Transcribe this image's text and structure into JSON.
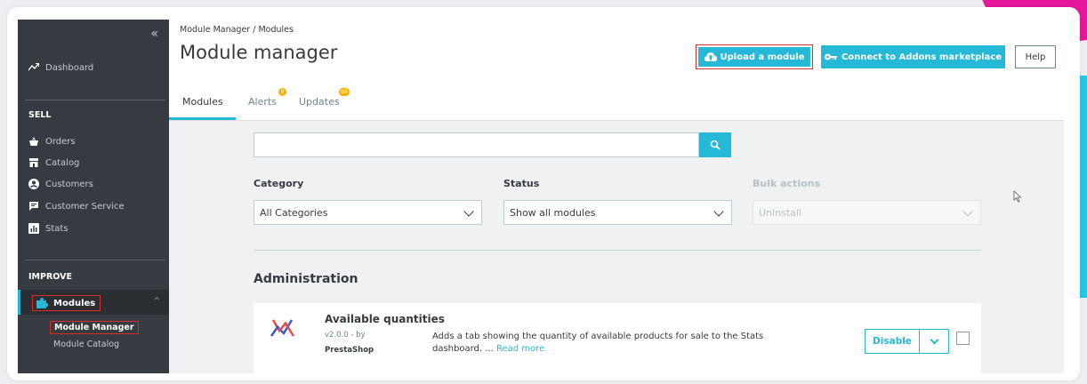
{
  "sidebar": {
    "collapse_glyph": "«",
    "dashboard": "Dashboard",
    "sell_heading": "SELL",
    "sell_items": [
      "Orders",
      "Catalog",
      "Customers",
      "Customer Service",
      "Stats"
    ],
    "improve_heading": "IMPROVE",
    "modules": "Modules",
    "sub_items": [
      "Module Manager",
      "Module Catalog"
    ]
  },
  "header": {
    "breadcrumb": "Module Manager / Modules",
    "title": "Module manager",
    "upload_label": "Upload a module",
    "connect_label": "Connect to Addons marketplace",
    "help_label": "Help"
  },
  "tabs": [
    {
      "label": "Modules"
    },
    {
      "label": "Alerts",
      "badge": "0"
    },
    {
      "label": "Updates",
      "badge": "99"
    }
  ],
  "filters": {
    "search_value": "",
    "category_label": "Category",
    "category_value": "All Categories",
    "status_label": "Status",
    "status_value": "Show all modules",
    "bulk_label": "Bulk actions",
    "bulk_value": "Uninstall"
  },
  "section": {
    "title": "Administration"
  },
  "module": {
    "name": "Available quantities",
    "version": "v2.0.0 - by",
    "author": "PrestaShop",
    "description": "Adds a tab showing the quantity of available products for sale to the Stats dashboard. ...",
    "read_more": "Read more",
    "disable_label": "Disable"
  },
  "colors": {
    "accent": "#25b9d7",
    "sidebar_bg": "#363a41",
    "highlight_border": "#d62e2e",
    "badge": "#fab000"
  }
}
